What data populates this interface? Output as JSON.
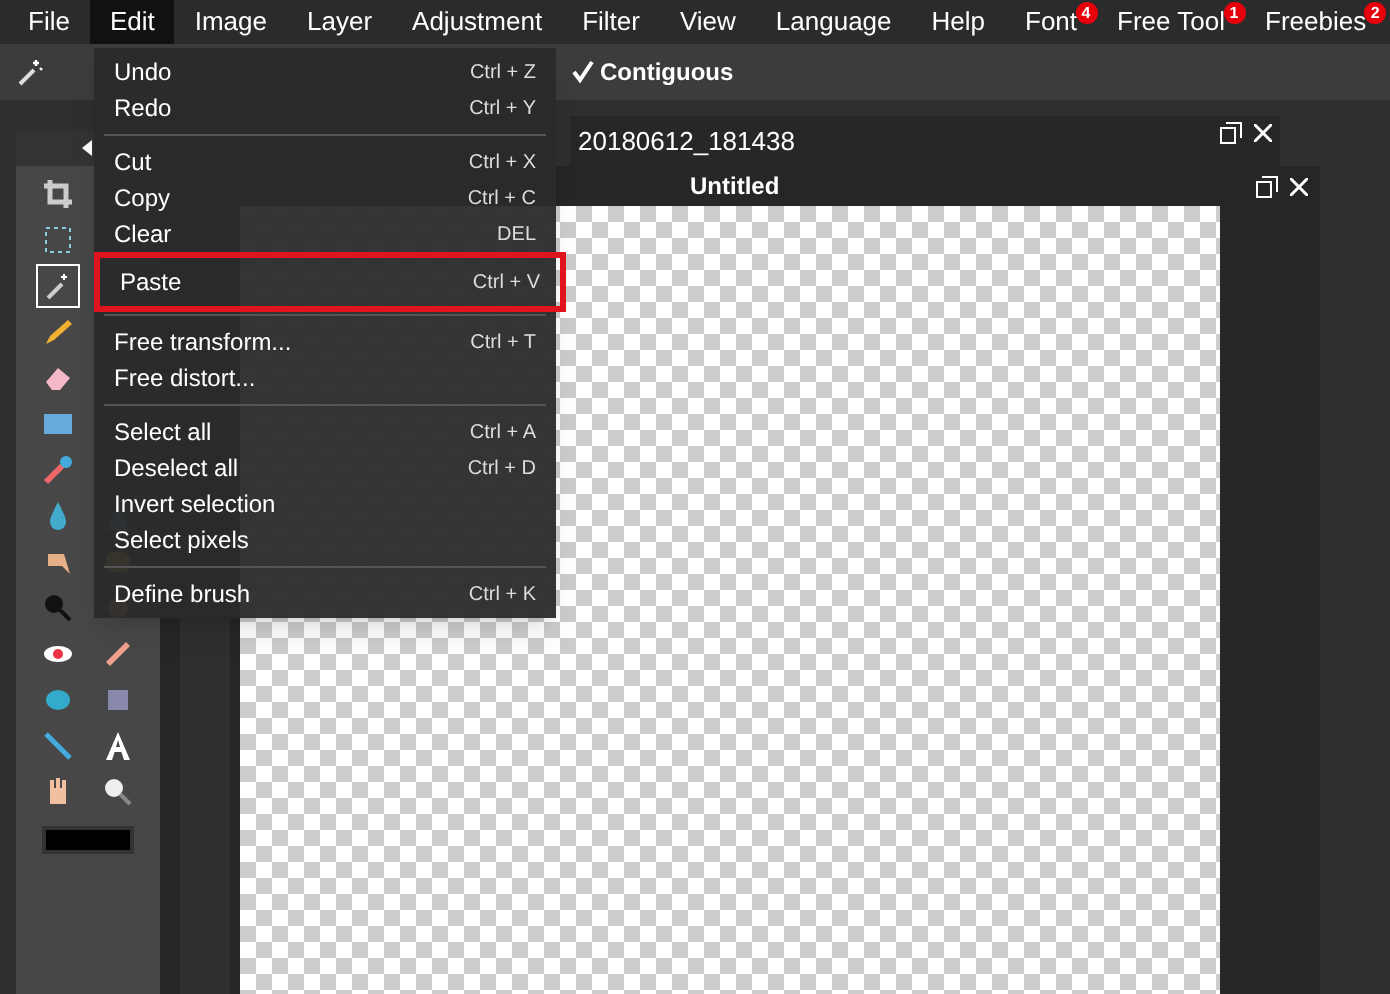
{
  "menu_bar": [
    {
      "label": "File",
      "selected": false
    },
    {
      "label": "Edit",
      "selected": true
    },
    {
      "label": "Image",
      "selected": false
    },
    {
      "label": "Layer",
      "selected": false
    },
    {
      "label": "Adjustment",
      "selected": false
    },
    {
      "label": "Filter",
      "selected": false
    },
    {
      "label": "View",
      "selected": false
    },
    {
      "label": "Language",
      "selected": false
    },
    {
      "label": "Help",
      "selected": false
    },
    {
      "label": "Font",
      "selected": false,
      "badge": "4"
    },
    {
      "label": "Free Tool",
      "selected": false,
      "badge": "1"
    },
    {
      "label": "Freebies",
      "selected": false,
      "badge": "2"
    }
  ],
  "toolbar": {
    "contiguous": {
      "label": "Contiguous",
      "checked": true
    }
  },
  "tools": [
    {
      "selected": false
    },
    {
      "selected": false
    },
    {
      "selected": true
    },
    {
      "selected": false
    },
    {
      "selected": false
    },
    {
      "selected": false
    },
    {
      "selected": false
    },
    {
      "selected": false
    },
    {
      "selected": false
    },
    {
      "selected": false
    },
    {
      "selected": false
    },
    {
      "selected": false
    },
    {
      "selected": false
    },
    {
      "selected": false
    },
    {
      "selected": false
    },
    {
      "selected": false
    },
    {
      "selected": false
    },
    {
      "selected": false
    },
    {
      "selected": false
    },
    {
      "selected": false
    },
    {
      "selected": false
    }
  ],
  "documents": [
    {
      "title": "20180612_181438"
    },
    {
      "title": "Untitled"
    }
  ],
  "edit_menu": [
    [
      {
        "label": "Undo",
        "shortcut": "Ctrl + Z",
        "highlighted": false
      },
      {
        "label": "Redo",
        "shortcut": "Ctrl + Y",
        "highlighted": false
      }
    ],
    [
      {
        "label": "Cut",
        "shortcut": "Ctrl + X",
        "highlighted": false
      },
      {
        "label": "Copy",
        "shortcut": "Ctrl + C",
        "highlighted": false
      },
      {
        "label": "Clear",
        "shortcut": "DEL",
        "highlighted": false
      },
      {
        "label": "Paste",
        "shortcut": "Ctrl + V",
        "highlighted": true
      }
    ],
    [
      {
        "label": "Free transform...",
        "shortcut": "Ctrl + T",
        "highlighted": false
      },
      {
        "label": "Free distort...",
        "highlighted": false
      }
    ],
    [
      {
        "label": "Select all",
        "shortcut": "Ctrl + A",
        "highlighted": false
      },
      {
        "label": "Deselect all",
        "shortcut": "Ctrl + D",
        "highlighted": false
      },
      {
        "label": "Invert selection",
        "highlighted": false
      },
      {
        "label": "Select pixels",
        "highlighted": false
      }
    ],
    [
      {
        "label": "Define brush",
        "shortcut": "Ctrl + K",
        "highlighted": false
      }
    ]
  ]
}
